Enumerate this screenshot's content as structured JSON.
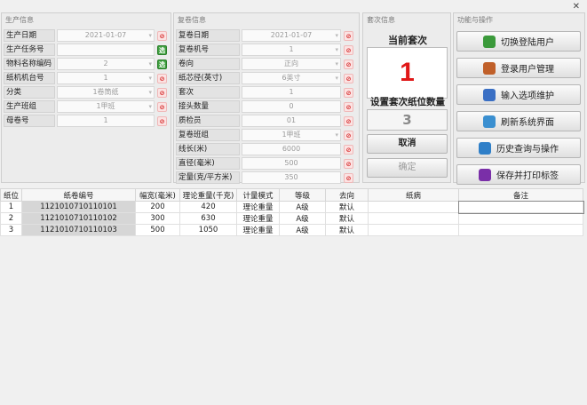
{
  "window": {
    "close_glyph": "✕"
  },
  "prod": {
    "title": "生产信息",
    "rows": [
      {
        "label": "生产日期",
        "value": "2021-01-07",
        "has_dropdown": true,
        "icon": "red"
      },
      {
        "label": "生产任务号",
        "value": "",
        "has_dropdown": false,
        "icon": "green-select"
      },
      {
        "label": "物料名称编码",
        "value": "2",
        "has_dropdown": true,
        "icon": "green-select"
      },
      {
        "label": "纸机机台号",
        "value": "1",
        "has_dropdown": true,
        "icon": "red"
      },
      {
        "label": "分类",
        "value": "1卷筒纸",
        "has_dropdown": true,
        "icon": "red"
      },
      {
        "label": "生产班组",
        "value": "1甲班",
        "has_dropdown": true,
        "icon": "red"
      },
      {
        "label": "母卷号",
        "value": "1",
        "has_dropdown": false,
        "icon": "red"
      }
    ]
  },
  "rewind": {
    "title": "复卷信息",
    "rows": [
      {
        "label": "复卷日期",
        "value": "2021-01-07",
        "has_dropdown": true
      },
      {
        "label": "复卷机号",
        "value": "1",
        "has_dropdown": true
      },
      {
        "label": "卷向",
        "value": "正向",
        "has_dropdown": true
      },
      {
        "label": "纸芯径(英寸)",
        "value": "6英寸",
        "has_dropdown": true
      },
      {
        "label": "套次",
        "value": "1",
        "has_dropdown": false
      },
      {
        "label": "接头数量",
        "value": "0",
        "has_dropdown": false
      },
      {
        "label": "质检员",
        "value": "01",
        "has_dropdown": false
      },
      {
        "label": "复卷班组",
        "value": "1甲班",
        "has_dropdown": true
      },
      {
        "label": "线长(米)",
        "value": "6000",
        "has_dropdown": false
      },
      {
        "label": "直径(毫米)",
        "value": "500",
        "has_dropdown": false
      },
      {
        "label": "定量(克/平方米)",
        "value": "350",
        "has_dropdown": false
      }
    ]
  },
  "sets": {
    "title": "套次信息",
    "current_label": "当前套次",
    "current_value": "1",
    "set_count_label": "设置套次纸位数量",
    "set_count_value": "3",
    "cancel_label": "取消",
    "confirm_label": "确定"
  },
  "functions": {
    "title": "功能与操作",
    "buttons": [
      {
        "label": "切换登陆用户",
        "icon": "users-icon",
        "color": "#3b9a3b"
      },
      {
        "label": "登录用户管理",
        "icon": "user-admin-icon",
        "color": "#c0602a"
      },
      {
        "label": "输入选项维护",
        "icon": "clipboard-icon",
        "color": "#3a6fc4"
      },
      {
        "label": "刷新系统界面",
        "icon": "refresh-icon",
        "color": "#3a8fd0"
      },
      {
        "label": "历史查询与操作",
        "icon": "history-icon",
        "color": "#2f7fc8"
      },
      {
        "label": "保存并打印标签",
        "icon": "save-icon",
        "color": "#7a2fa8"
      }
    ]
  },
  "table": {
    "headers": [
      "纸位",
      "纸卷编号",
      "幅宽(毫米)",
      "理论重量(千克)",
      "计量模式",
      "等级",
      "去向",
      "纸病",
      "备注"
    ],
    "rows": [
      [
        "1",
        "1121010710110101",
        "200",
        "420",
        "理论重量",
        "A级",
        "默认",
        "",
        ""
      ],
      [
        "2",
        "1121010710110102",
        "300",
        "630",
        "理论重量",
        "A级",
        "默认",
        "",
        ""
      ],
      [
        "3",
        "1121010710110103",
        "500",
        "1050",
        "理论重量",
        "A级",
        "默认",
        "",
        ""
      ]
    ]
  }
}
